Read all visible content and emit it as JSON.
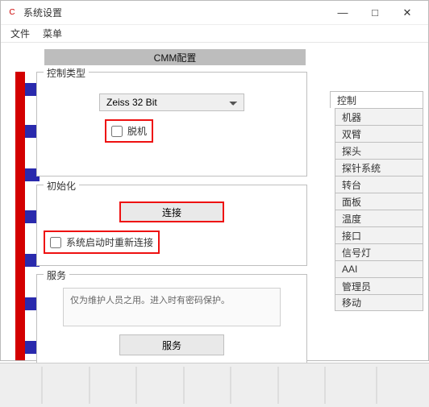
{
  "window": {
    "title": "系统设置",
    "menu": {
      "file": "文件",
      "menu": "菜单"
    },
    "controls": {
      "min": "—",
      "max": "□",
      "close": "✕"
    }
  },
  "banner": "CMM配置",
  "groups": {
    "control_type": {
      "legend": "控制类型",
      "combo_value": "Zeiss 32 Bit",
      "offline_label": "脱机"
    },
    "init": {
      "legend": "初始化",
      "connect_btn": "连接",
      "reconnect_label": "系统启动时重新连接"
    },
    "service": {
      "legend": "服务",
      "info": "仅为维护人员之用。进入时有密码保护。",
      "service_btn": "服务"
    }
  },
  "tabs": [
    "控制",
    "机器",
    "双臂",
    "探头",
    "探针系统",
    "转台",
    "面板",
    "温度",
    "接口",
    "信号灯",
    "AAI",
    "管理员",
    "移动"
  ]
}
